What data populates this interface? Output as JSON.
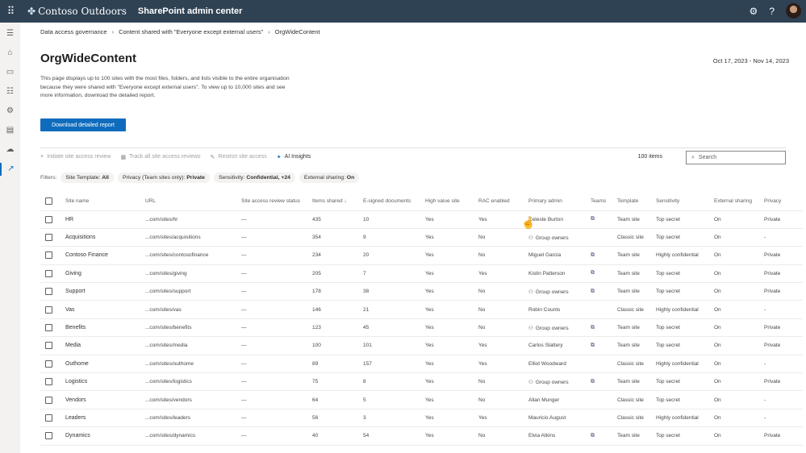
{
  "topbar": {
    "org": "Contoso Outdoors",
    "app": "SharePoint admin center",
    "help": "?"
  },
  "breadcrumb": [
    "Data access governance",
    "Content shared with \"Everyone except external users\"",
    "OrgWideContent"
  ],
  "page": {
    "title": "OrgWideContent",
    "date_range": "Oct 17, 2023 - Nov 14, 2023",
    "description": "This page displays up to 100 sites with the most files, folders, and lists visible to the entire organisation because they were shared with \"Everyone except external users\". To view up to 10,000 sites and see more information, download the detailed report.",
    "download_label": "Download detailed report"
  },
  "commands": {
    "initiate": "Initiate site access review",
    "track": "Track all site access reviews",
    "restrict": "Restrict site access",
    "insights": "AI Insights",
    "count": "100 items",
    "search_placeholder": "Search"
  },
  "filters": {
    "label": "Filters:",
    "items": [
      {
        "k": "Site Template:",
        "v": "All"
      },
      {
        "k": "Privacy (Team sites only):",
        "v": "Private"
      },
      {
        "k": "Sensitivity:",
        "v": "Confidential, +24"
      },
      {
        "k": "External sharing:",
        "v": "On"
      }
    ]
  },
  "columns": [
    "Site name",
    "URL",
    "Site access review status",
    "Items shared ↓",
    "E-signed documents",
    "High value site",
    "RAC enabled",
    "Primary admin",
    "Teams",
    "Template",
    "Sensitivity",
    "External sharing",
    "Privacy"
  ],
  "rows": [
    {
      "name": "HR",
      "url": "...com/sites/hr",
      "status": "—",
      "items": "435",
      "esigned": "10",
      "hv": "Yes",
      "rac": "Yes",
      "admin": "Celeste Burton",
      "group": false,
      "teams": true,
      "template": "Team site",
      "sens": "Top secret",
      "ext": "On",
      "privacy": "Private"
    },
    {
      "name": "Acquisitions",
      "url": "...com/sites/acquisitions",
      "status": "—",
      "items": "354",
      "esigned": "9",
      "hv": "Yes",
      "rac": "No",
      "admin": "Group owners",
      "group": true,
      "teams": false,
      "template": "Classic site",
      "sens": "Top secret",
      "ext": "On",
      "privacy": "-"
    },
    {
      "name": "Contoso Finance",
      "url": "...com/sites/contosofinance",
      "status": "—",
      "items": "234",
      "esigned": "20",
      "hv": "Yes",
      "rac": "No",
      "admin": "Miguel Garcia",
      "group": false,
      "teams": true,
      "template": "Team site",
      "sens": "Highly confidential",
      "ext": "On",
      "privacy": "Private"
    },
    {
      "name": "Giving",
      "url": "...com/sites/giving",
      "status": "—",
      "items": "205",
      "esigned": "7",
      "hv": "Yes",
      "rac": "Yes",
      "admin": "Kistin Patterson",
      "group": false,
      "teams": true,
      "template": "Team site",
      "sens": "Top secret",
      "ext": "On",
      "privacy": "Private"
    },
    {
      "name": "Support",
      "url": "...com/sites/support",
      "status": "—",
      "items": "178",
      "esigned": "38",
      "hv": "Yes",
      "rac": "No",
      "admin": "Group owners",
      "group": true,
      "teams": true,
      "template": "Team site",
      "sens": "Top secret",
      "ext": "On",
      "privacy": "Private"
    },
    {
      "name": "Vas",
      "url": "...com/sites/vas",
      "status": "—",
      "items": "146",
      "esigned": "21",
      "hv": "Yes",
      "rac": "No",
      "admin": "Robin Counts",
      "group": false,
      "teams": false,
      "template": "Classic site",
      "sens": "Highly confidential",
      "ext": "On",
      "privacy": "-"
    },
    {
      "name": "Benefits",
      "url": "...com/sites/benefits",
      "status": "—",
      "items": "123",
      "esigned": "45",
      "hv": "Yes",
      "rac": "No",
      "admin": "Group owners",
      "group": true,
      "teams": true,
      "template": "Team site",
      "sens": "Top secret",
      "ext": "On",
      "privacy": "Private"
    },
    {
      "name": "Media",
      "url": "...com/sites/media",
      "status": "—",
      "items": "100",
      "esigned": "101",
      "hv": "Yes",
      "rac": "Yes",
      "admin": "Carlos Slattery",
      "group": false,
      "teams": true,
      "template": "Team site",
      "sens": "Top secret",
      "ext": "On",
      "privacy": "Private"
    },
    {
      "name": "Outhome",
      "url": "...com/sites/outhome",
      "status": "—",
      "items": "89",
      "esigned": "157",
      "hv": "Yes",
      "rac": "Yes",
      "admin": "Elliot Woodward",
      "group": false,
      "teams": false,
      "template": "Classic site",
      "sens": "Highly confidential",
      "ext": "On",
      "privacy": "-"
    },
    {
      "name": "Logistics",
      "url": "...com/sites/logistics",
      "status": "—",
      "items": "75",
      "esigned": "8",
      "hv": "Yes",
      "rac": "No",
      "admin": "Group owners",
      "group": true,
      "teams": true,
      "template": "Team site",
      "sens": "Top secret",
      "ext": "On",
      "privacy": "Private"
    },
    {
      "name": "Vendors",
      "url": "...com/sites/vendors",
      "status": "—",
      "items": "64",
      "esigned": "5",
      "hv": "Yes",
      "rac": "No",
      "admin": "Allan Munger",
      "group": false,
      "teams": false,
      "template": "Classic site",
      "sens": "Top secret",
      "ext": "On",
      "privacy": "-"
    },
    {
      "name": "Leaders",
      "url": "...com/sites/leaders",
      "status": "—",
      "items": "56",
      "esigned": "3",
      "hv": "Yes",
      "rac": "Yes",
      "admin": "Mauricio August",
      "group": false,
      "teams": false,
      "template": "Classic site",
      "sens": "Highly confidential",
      "ext": "On",
      "privacy": "-"
    },
    {
      "name": "Dynamics",
      "url": "...com/sites/dynamics",
      "status": "—",
      "items": "40",
      "esigned": "54",
      "hv": "Yes",
      "rac": "No",
      "admin": "Elvia Atkins",
      "group": false,
      "teams": true,
      "template": "Team site",
      "sens": "Top secret",
      "ext": "On",
      "privacy": "Private"
    }
  ]
}
